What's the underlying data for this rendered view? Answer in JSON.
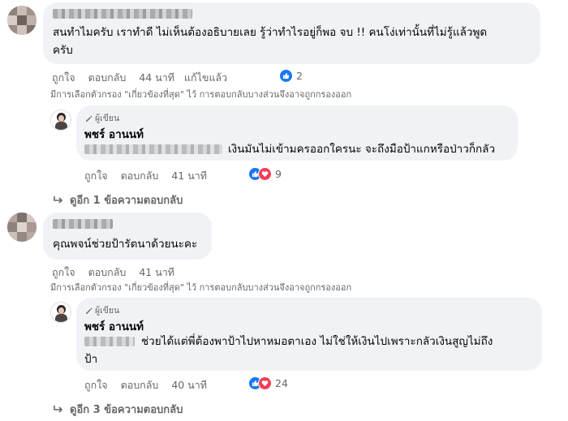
{
  "comments": [
    {
      "text_line1": "สนทำไมครับ เราทำดี ไม่เห็นต้องอธิบายเลย รู้ว่าทำไรอยู่ก็พอ จบ !! คนโง่เท่านั้นที่ไม่รู้แล้วพูด",
      "text_line2": "ครับ",
      "like_label": "ถูกใจ",
      "reply_label": "ตอบกลับ",
      "time": "44 นาที",
      "edited_label": "แก้ไขแล้ว",
      "reaction_count": "2",
      "filter_note": "มีการเลือกตัวกรอง \"เกี่ยวข้องที่สุด\" ไว้ การตอบกลับบางส่วนจึงอาจถูกกรองออก",
      "reply": {
        "badge": "ผู้เขียน",
        "author": "พชร์ อานนท์",
        "text_line1": "เงินมันไม่เข้ามครออกใครนะ จะถึงมือป้าแกหรือป่าวก็กลัว",
        "like_label": "ถูกใจ",
        "reply_label": "ตอบกลับ",
        "time": "41 นาที",
        "reaction_count": "9"
      },
      "more_replies": "ดูอีก 1 ข้อความตอบกลับ"
    },
    {
      "text_line1": "คุณพจน์ช่วยป้ารัตนาด้วยนะคะ",
      "like_label": "ถูกใจ",
      "reply_label": "ตอบกลับ",
      "time": "41 นาที",
      "filter_note": "มีการเลือกตัวกรอง \"เกี่ยวข้องที่สุด\" ไว้ การตอบกลับบางส่วนจึงอาจถูกกรองออก",
      "reply": {
        "badge": "ผู้เขียน",
        "author": "พชร์ อานนท์",
        "text_line1": "ช่วยได้แต่พี่ต้องพาป้าไปหาหมอตาเอง ไม่ใช่ให้เงินไปเพราะกลัวเงินสูญไม่ถึง",
        "text_line2": "ป้า",
        "like_label": "ถูกใจ",
        "reply_label": "ตอบกลับ",
        "time": "40 นาที",
        "reaction_count": "24"
      },
      "more_replies": "ดูอีก 3 ข้อความตอบกลับ"
    }
  ],
  "colors": {
    "like_blue": "#1877f2",
    "love_red": "#f33e58",
    "bubble_bg": "#f0f2f5",
    "meta_gray": "#65676b"
  },
  "icons": [
    "like-icon",
    "love-icon",
    "author-badge-icon",
    "reply-arrow-icon"
  ]
}
